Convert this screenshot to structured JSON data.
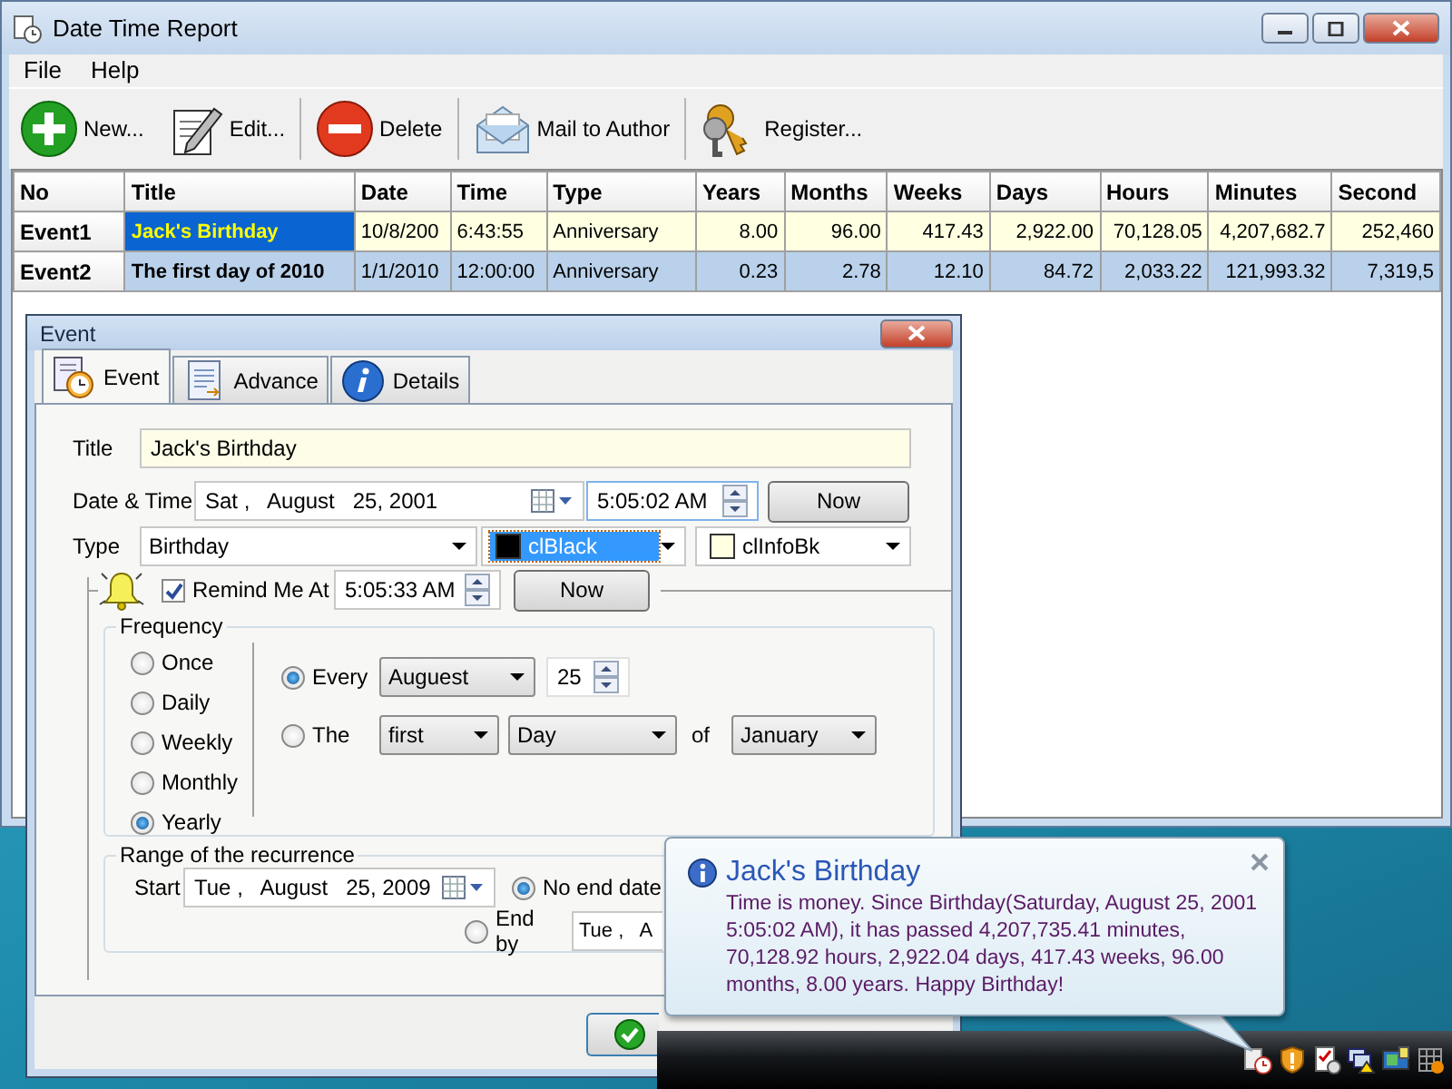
{
  "main_window": {
    "title": "Date Time Report",
    "menu": [
      "File",
      "Help"
    ],
    "toolbar": [
      {
        "label": "New..."
      },
      {
        "label": "Edit..."
      },
      {
        "label": "Delete"
      },
      {
        "label": "Mail to Author"
      },
      {
        "label": "Register..."
      }
    ],
    "table": {
      "columns": [
        "No",
        "Title",
        "Date",
        "Time",
        "Type",
        "Years",
        "Months",
        "Weeks",
        "Days",
        "Hours",
        "Minutes",
        "Second"
      ],
      "rows": [
        {
          "color": "#ffffe1",
          "selected": true,
          "cells": [
            "Event1",
            "Jack's Birthday",
            "10/8/200",
            "6:43:55",
            "Anniversary",
            "8.00",
            "96.00",
            "417.43",
            "2,922.00",
            "70,128.05",
            "4,207,682.7",
            "252,460"
          ]
        },
        {
          "color": "#b9d1ea",
          "selected": false,
          "cells": [
            "Event2",
            "The first day of 2010",
            "1/1/2010",
            "12:00:00",
            "Anniversary",
            "0.23",
            "2.78",
            "12.10",
            "84.72",
            "2,033.22",
            "121,993.32",
            "7,319,5"
          ]
        }
      ]
    }
  },
  "event_dialog": {
    "title": "Event",
    "tabs": [
      {
        "label": "Event",
        "selected": true
      },
      {
        "label": "Advance",
        "selected": false
      },
      {
        "label": "Details",
        "selected": false
      }
    ],
    "title_label": "Title",
    "title_value": "Jack's Birthday",
    "datetime_label": "Date & Time",
    "date_value": "Sat ,   August   25, 2001",
    "time_value": "5:05:02 AM",
    "now_button": "Now",
    "type_label": "Type",
    "type_value": "Birthday",
    "color_boxes": [
      {
        "name": "clBlack",
        "color": "#000000",
        "focused": true
      },
      {
        "name": "clInfoBk",
        "color": "#ffffe1",
        "focused": false
      }
    ],
    "remind": {
      "label": "Remind Me At",
      "checked": true,
      "time": "5:05:33 AM",
      "now_button": "Now"
    },
    "frequency": {
      "title": "Frequency",
      "options": [
        {
          "label": "Once",
          "selected": false
        },
        {
          "label": "Daily",
          "selected": false
        },
        {
          "label": "Weekly",
          "selected": false
        },
        {
          "label": "Monthly",
          "selected": false
        },
        {
          "label": "Yearly",
          "selected": true
        }
      ],
      "every": {
        "label": "Every",
        "selected": true,
        "month": "Auguest",
        "day": "25"
      },
      "the": {
        "label": "The",
        "selected": false,
        "ordinal": "first",
        "unit": "Day",
        "of": "of",
        "month": "January"
      }
    },
    "range": {
      "title": "Range of the recurrence",
      "start_label": "Start",
      "start_date": "Tue ,   August   25, 2009",
      "no_end": {
        "label": "No end date",
        "selected": true
      },
      "end_by": {
        "label": "End by",
        "selected": false,
        "date": "Tue ,   A"
      }
    }
  },
  "balloon": {
    "title": "Jack's Birthday",
    "text": "Time is money. Since Birthday(Saturday, August 25, 2001 5:05:02 AM), it has passed 4,207,735.41 minutes, 70,128.92 hours, 2,922.04 days, 417.43 weeks, 96.00 months, 8.00 years. Happy Birthday!"
  }
}
